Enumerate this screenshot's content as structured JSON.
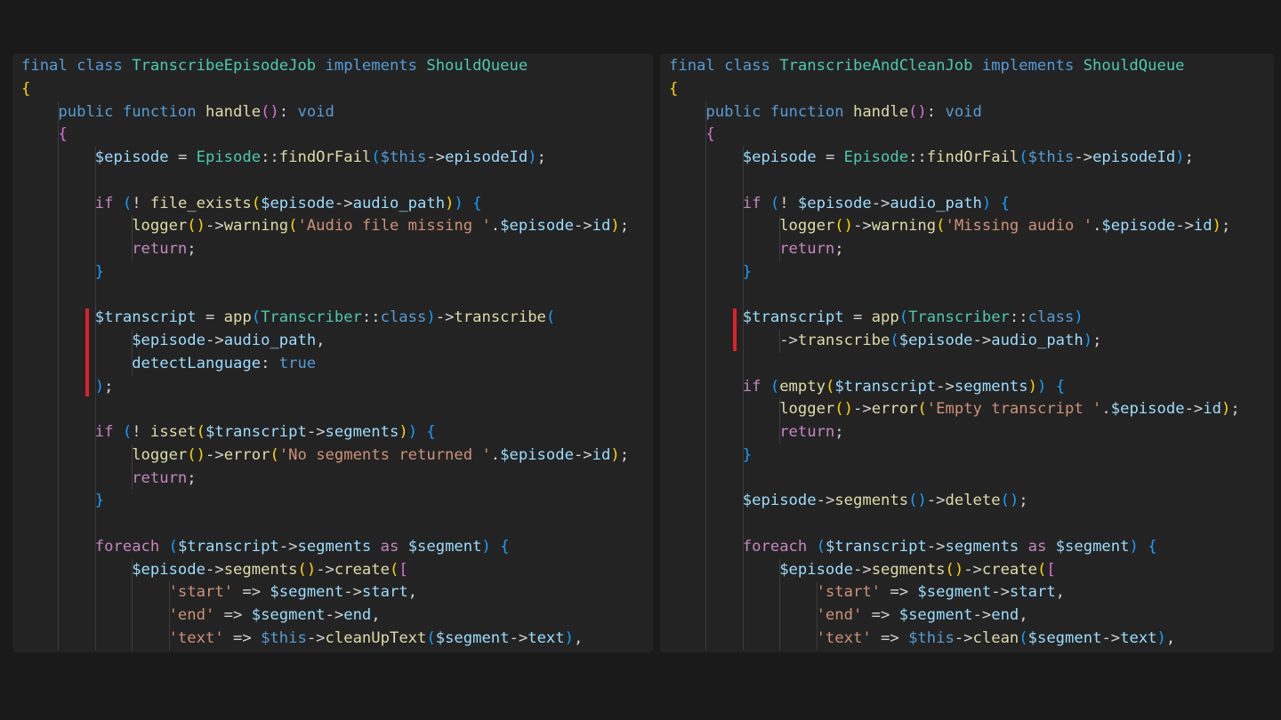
{
  "panes": [
    {
      "id": "left",
      "title": "TranscribeEpisodeJob",
      "lines": [
        [
          [
            "final class ",
            "kw"
          ],
          [
            "TranscribeEpisodeJob",
            "cls"
          ],
          [
            " implements ",
            "kw"
          ],
          [
            "ShouldQueue",
            "cls"
          ]
        ],
        [
          [
            "{",
            "br1"
          ]
        ],
        [
          [
            "    "
          ],
          [
            "public function ",
            "kw"
          ],
          [
            "handle",
            "fn"
          ],
          [
            "()",
            "br2"
          ],
          [
            ": "
          ],
          [
            "void",
            "kw"
          ]
        ],
        [
          [
            "    "
          ],
          [
            "{",
            "br2"
          ]
        ],
        [
          [
            "        "
          ],
          [
            "$episode",
            "var"
          ],
          [
            " = "
          ],
          [
            "Episode",
            "cls"
          ],
          [
            "::"
          ],
          [
            "findOrFail",
            "fn"
          ],
          [
            "(",
            "br3"
          ],
          [
            "$this",
            "kw"
          ],
          [
            "->"
          ],
          [
            "episodeId",
            "var"
          ],
          [
            ")",
            "br3"
          ],
          [
            ";"
          ]
        ],
        [
          [
            ""
          ]
        ],
        [
          [
            "        "
          ],
          [
            "if ",
            "ctl"
          ],
          [
            "(",
            "br3"
          ],
          [
            "! "
          ],
          [
            "file_exists",
            "fn"
          ],
          [
            "(",
            "br1"
          ],
          [
            "$episode",
            "var"
          ],
          [
            "->"
          ],
          [
            "audio_path",
            "var"
          ],
          [
            ")",
            "br1"
          ],
          [
            ")",
            "br3"
          ],
          [
            " "
          ],
          [
            "{",
            "br3"
          ]
        ],
        [
          [
            "            "
          ],
          [
            "logger",
            "fn"
          ],
          [
            "()",
            "br1"
          ],
          [
            "->"
          ],
          [
            "warning",
            "fn"
          ],
          [
            "(",
            "br1"
          ],
          [
            "'Audio file missing '",
            "str"
          ],
          [
            "."
          ],
          [
            "$episode",
            "var"
          ],
          [
            "->"
          ],
          [
            "id",
            "var"
          ],
          [
            ")",
            "br1"
          ],
          [
            ";"
          ]
        ],
        [
          [
            "            "
          ],
          [
            "return",
            "ctl"
          ],
          [
            ";"
          ]
        ],
        [
          [
            "        "
          ],
          [
            "}",
            "br3"
          ]
        ],
        [
          [
            ""
          ]
        ],
        [
          [
            "        "
          ],
          [
            "$transcript",
            "var"
          ],
          [
            " = "
          ],
          [
            "app",
            "fn"
          ],
          [
            "(",
            "br3"
          ],
          [
            "Transcriber",
            "cls"
          ],
          [
            "::"
          ],
          [
            "class",
            "kw"
          ],
          [
            ")",
            "br3"
          ],
          [
            "->"
          ],
          [
            "transcribe",
            "fn"
          ],
          [
            "(",
            "br3"
          ]
        ],
        [
          [
            "            "
          ],
          [
            "$episode",
            "var"
          ],
          [
            "->"
          ],
          [
            "audio_path",
            "var"
          ],
          [
            ","
          ]
        ],
        [
          [
            "            "
          ],
          [
            "detectLanguage",
            "var"
          ],
          [
            ": "
          ],
          [
            "true",
            "kw"
          ]
        ],
        [
          [
            "        "
          ],
          [
            ")",
            "br3"
          ],
          [
            ";"
          ]
        ],
        [
          [
            ""
          ]
        ],
        [
          [
            "        "
          ],
          [
            "if ",
            "ctl"
          ],
          [
            "(",
            "br3"
          ],
          [
            "! "
          ],
          [
            "isset",
            "fn"
          ],
          [
            "(",
            "br1"
          ],
          [
            "$transcript",
            "var"
          ],
          [
            "->"
          ],
          [
            "segments",
            "var"
          ],
          [
            ")",
            "br1"
          ],
          [
            ")",
            "br3"
          ],
          [
            " "
          ],
          [
            "{",
            "br3"
          ]
        ],
        [
          [
            "            "
          ],
          [
            "logger",
            "fn"
          ],
          [
            "()",
            "br1"
          ],
          [
            "->"
          ],
          [
            "error",
            "fn"
          ],
          [
            "(",
            "br1"
          ],
          [
            "'No segments returned '",
            "str"
          ],
          [
            "."
          ],
          [
            "$episode",
            "var"
          ],
          [
            "->"
          ],
          [
            "id",
            "var"
          ],
          [
            ")",
            "br1"
          ],
          [
            ";"
          ]
        ],
        [
          [
            "            "
          ],
          [
            "return",
            "ctl"
          ],
          [
            ";"
          ]
        ],
        [
          [
            "        "
          ],
          [
            "}",
            "br3"
          ]
        ],
        [
          [
            ""
          ]
        ],
        [
          [
            "        "
          ],
          [
            "foreach ",
            "ctl"
          ],
          [
            "(",
            "br3"
          ],
          [
            "$transcript",
            "var"
          ],
          [
            "->"
          ],
          [
            "segments",
            "var"
          ],
          [
            " as ",
            "ctl"
          ],
          [
            "$segment",
            "var"
          ],
          [
            ")",
            "br3"
          ],
          [
            " "
          ],
          [
            "{",
            "br3"
          ]
        ],
        [
          [
            "            "
          ],
          [
            "$episode",
            "var"
          ],
          [
            "->"
          ],
          [
            "segments",
            "fn"
          ],
          [
            "()",
            "br1"
          ],
          [
            "->"
          ],
          [
            "create",
            "fn"
          ],
          [
            "(",
            "br1"
          ],
          [
            "[",
            "br2"
          ]
        ],
        [
          [
            "                "
          ],
          [
            "'start'",
            "str"
          ],
          [
            " => "
          ],
          [
            "$segment",
            "var"
          ],
          [
            "->"
          ],
          [
            "start",
            "var"
          ],
          [
            ","
          ]
        ],
        [
          [
            "                "
          ],
          [
            "'end'",
            "str"
          ],
          [
            " => "
          ],
          [
            "$segment",
            "var"
          ],
          [
            "->"
          ],
          [
            "end",
            "var"
          ],
          [
            ","
          ]
        ],
        [
          [
            "                "
          ],
          [
            "'text'",
            "str"
          ],
          [
            " => "
          ],
          [
            "$this",
            "kw"
          ],
          [
            "->"
          ],
          [
            "cleanUpText",
            "fn"
          ],
          [
            "(",
            "br3"
          ],
          [
            "$segment",
            "var"
          ],
          [
            "->"
          ],
          [
            "text",
            "var"
          ],
          [
            ")",
            "br3"
          ],
          [
            ","
          ]
        ]
      ]
    },
    {
      "id": "right",
      "title": "TranscribeAndCleanJob",
      "lines": [
        [
          [
            "final class ",
            "kw"
          ],
          [
            "TranscribeAndCleanJob",
            "cls"
          ],
          [
            " implements ",
            "kw"
          ],
          [
            "ShouldQueue",
            "cls"
          ]
        ],
        [
          [
            "{",
            "br1"
          ]
        ],
        [
          [
            "    "
          ],
          [
            "public function ",
            "kw"
          ],
          [
            "handle",
            "fn"
          ],
          [
            "()",
            "br2"
          ],
          [
            ": "
          ],
          [
            "void",
            "kw"
          ]
        ],
        [
          [
            "    "
          ],
          [
            "{",
            "br2"
          ]
        ],
        [
          [
            "        "
          ],
          [
            "$episode",
            "var"
          ],
          [
            " = "
          ],
          [
            "Episode",
            "cls"
          ],
          [
            "::"
          ],
          [
            "findOrFail",
            "fn"
          ],
          [
            "(",
            "br3"
          ],
          [
            "$this",
            "kw"
          ],
          [
            "->"
          ],
          [
            "episodeId",
            "var"
          ],
          [
            ")",
            "br3"
          ],
          [
            ";"
          ]
        ],
        [
          [
            ""
          ]
        ],
        [
          [
            "        "
          ],
          [
            "if ",
            "ctl"
          ],
          [
            "(",
            "br3"
          ],
          [
            "! "
          ],
          [
            "$episode",
            "var"
          ],
          [
            "->"
          ],
          [
            "audio_path",
            "var"
          ],
          [
            ")",
            "br3"
          ],
          [
            " "
          ],
          [
            "{",
            "br3"
          ]
        ],
        [
          [
            "            "
          ],
          [
            "logger",
            "fn"
          ],
          [
            "()",
            "br1"
          ],
          [
            "->"
          ],
          [
            "warning",
            "fn"
          ],
          [
            "(",
            "br1"
          ],
          [
            "'Missing audio '",
            "str"
          ],
          [
            "."
          ],
          [
            "$episode",
            "var"
          ],
          [
            "->"
          ],
          [
            "id",
            "var"
          ],
          [
            ")",
            "br1"
          ],
          [
            ";"
          ]
        ],
        [
          [
            "            "
          ],
          [
            "return",
            "ctl"
          ],
          [
            ";"
          ]
        ],
        [
          [
            "        "
          ],
          [
            "}",
            "br3"
          ]
        ],
        [
          [
            ""
          ]
        ],
        [
          [
            "        "
          ],
          [
            "$transcript",
            "var"
          ],
          [
            " = "
          ],
          [
            "app",
            "fn"
          ],
          [
            "(",
            "br3"
          ],
          [
            "Transcriber",
            "cls"
          ],
          [
            "::"
          ],
          [
            "class",
            "kw"
          ],
          [
            ")",
            "br3"
          ]
        ],
        [
          [
            "            "
          ],
          [
            "->"
          ],
          [
            "transcribe",
            "fn"
          ],
          [
            "(",
            "br3"
          ],
          [
            "$episode",
            "var"
          ],
          [
            "->"
          ],
          [
            "audio_path",
            "var"
          ],
          [
            ")",
            "br3"
          ],
          [
            ";"
          ]
        ],
        [
          [
            ""
          ]
        ],
        [
          [
            "        "
          ],
          [
            "if ",
            "ctl"
          ],
          [
            "(",
            "br3"
          ],
          [
            "empty",
            "fn"
          ],
          [
            "(",
            "br1"
          ],
          [
            "$transcript",
            "var"
          ],
          [
            "->"
          ],
          [
            "segments",
            "var"
          ],
          [
            ")",
            "br1"
          ],
          [
            ")",
            "br3"
          ],
          [
            " "
          ],
          [
            "{",
            "br3"
          ]
        ],
        [
          [
            "            "
          ],
          [
            "logger",
            "fn"
          ],
          [
            "()",
            "br1"
          ],
          [
            "->"
          ],
          [
            "error",
            "fn"
          ],
          [
            "(",
            "br1"
          ],
          [
            "'Empty transcript '",
            "str"
          ],
          [
            "."
          ],
          [
            "$episode",
            "var"
          ],
          [
            "->"
          ],
          [
            "id",
            "var"
          ],
          [
            ")",
            "br1"
          ],
          [
            ";"
          ]
        ],
        [
          [
            "            "
          ],
          [
            "return",
            "ctl"
          ],
          [
            ";"
          ]
        ],
        [
          [
            "        "
          ],
          [
            "}",
            "br3"
          ]
        ],
        [
          [
            ""
          ]
        ],
        [
          [
            "        "
          ],
          [
            "$episode",
            "var"
          ],
          [
            "->"
          ],
          [
            "segments",
            "fn"
          ],
          [
            "()",
            "br3"
          ],
          [
            "->"
          ],
          [
            "delete",
            "fn"
          ],
          [
            "()",
            "br3"
          ],
          [
            ";"
          ]
        ],
        [
          [
            ""
          ]
        ],
        [
          [
            "        "
          ],
          [
            "foreach ",
            "ctl"
          ],
          [
            "(",
            "br3"
          ],
          [
            "$transcript",
            "var"
          ],
          [
            "->"
          ],
          [
            "segments",
            "var"
          ],
          [
            " as ",
            "ctl"
          ],
          [
            "$segment",
            "var"
          ],
          [
            ")",
            "br3"
          ],
          [
            " "
          ],
          [
            "{",
            "br3"
          ]
        ],
        [
          [
            "            "
          ],
          [
            "$episode",
            "var"
          ],
          [
            "->"
          ],
          [
            "segments",
            "fn"
          ],
          [
            "()",
            "br1"
          ],
          [
            "->"
          ],
          [
            "create",
            "fn"
          ],
          [
            "(",
            "br1"
          ],
          [
            "[",
            "br2"
          ]
        ],
        [
          [
            "                "
          ],
          [
            "'start'",
            "str"
          ],
          [
            " => "
          ],
          [
            "$segment",
            "var"
          ],
          [
            "->"
          ],
          [
            "start",
            "var"
          ],
          [
            ","
          ]
        ],
        [
          [
            "                "
          ],
          [
            "'end'",
            "str"
          ],
          [
            " => "
          ],
          [
            "$segment",
            "var"
          ],
          [
            "->"
          ],
          [
            "end",
            "var"
          ],
          [
            ","
          ]
        ],
        [
          [
            "                "
          ],
          [
            "'text'",
            "str"
          ],
          [
            " => "
          ],
          [
            "$this",
            "kw"
          ],
          [
            "->"
          ],
          [
            "clean",
            "fn"
          ],
          [
            "(",
            "br3"
          ],
          [
            "$segment",
            "var"
          ],
          [
            "->"
          ],
          [
            "text",
            "var"
          ],
          [
            ")",
            "br3"
          ],
          [
            ","
          ]
        ]
      ]
    }
  ]
}
